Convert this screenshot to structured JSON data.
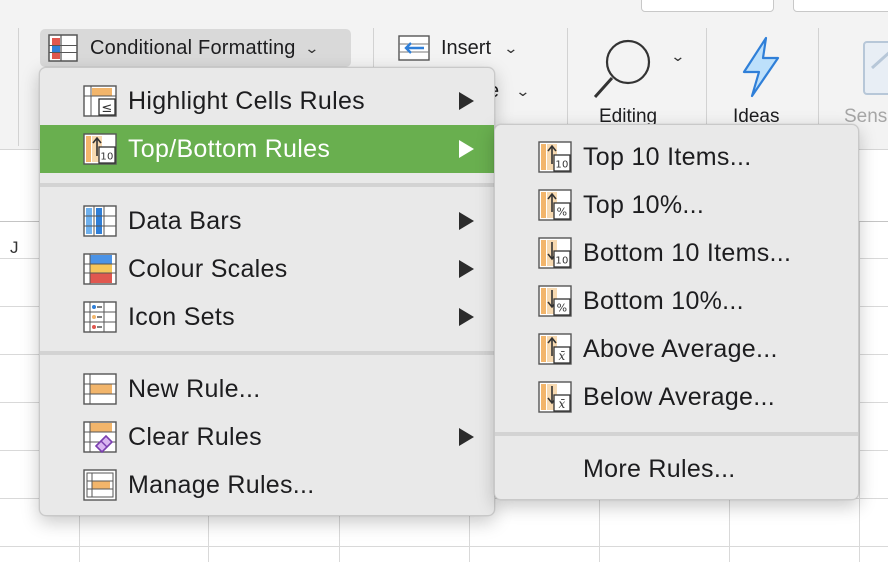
{
  "ribbon": {
    "conditional_formatting": "Conditional Formatting",
    "insert": "Insert",
    "format_partial": "e",
    "editing": "Editing",
    "ideas": "Ideas",
    "sensitivity_partial": "Sens",
    "column_label": "J"
  },
  "main_menu": {
    "items": [
      {
        "label": "Highlight Cells Rules",
        "icon": "highlight-cells-icon",
        "submenu": true
      },
      {
        "label": "Top/Bottom Rules",
        "icon": "top-bottom-icon",
        "submenu": true,
        "active": true
      },
      {
        "label": "Data Bars",
        "icon": "data-bars-icon",
        "submenu": true
      },
      {
        "label": "Colour Scales",
        "icon": "colour-scales-icon",
        "submenu": true
      },
      {
        "label": "Icon Sets",
        "icon": "icon-sets-icon",
        "submenu": true
      },
      {
        "label": "New Rule...",
        "icon": "new-rule-icon",
        "submenu": false
      },
      {
        "label": "Clear Rules",
        "icon": "clear-rules-icon",
        "submenu": true
      },
      {
        "label": "Manage Rules...",
        "icon": "manage-rules-icon",
        "submenu": false
      }
    ]
  },
  "sub_menu": {
    "items": [
      {
        "label": "Top 10 Items...",
        "icon": "top-10-items-icon",
        "badge": "10"
      },
      {
        "label": "Top 10%...",
        "icon": "top-10-percent-icon",
        "badge": "%"
      },
      {
        "label": "Bottom 10 Items...",
        "icon": "bottom-10-items-icon",
        "badge": "10"
      },
      {
        "label": "Bottom 10%...",
        "icon": "bottom-10-percent-icon",
        "badge": "%"
      },
      {
        "label": "Above Average...",
        "icon": "above-average-icon",
        "badge": "x̄"
      },
      {
        "label": "Below Average...",
        "icon": "below-average-icon",
        "badge": "x̄"
      },
      {
        "label": "More Rules...",
        "icon": "",
        "badge": ""
      }
    ]
  },
  "colors": {
    "highlight": "#69af4f",
    "menu_bg": "#e9e9e9",
    "accent_blue": "#2f7fd8",
    "accent_orange": "#f2b56b",
    "accent_red": "#e0574f"
  }
}
